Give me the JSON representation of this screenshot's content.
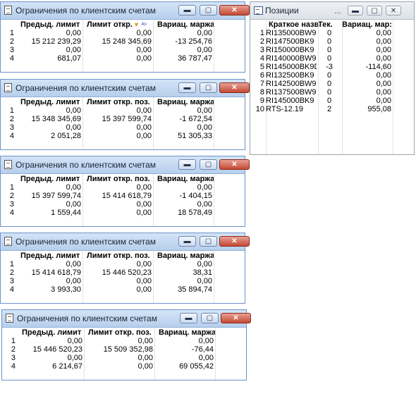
{
  "limit_windows": [
    {
      "title": "Ограничения по клиентским счетам",
      "headers": [
        "Предыд. лимит",
        "Лимит откр.",
        "Вариац. маржа"
      ],
      "filter_icons": true,
      "rows": [
        [
          "1",
          "0,00",
          "0,00",
          "0,00"
        ],
        [
          "2",
          "15 212 239,29",
          "15 248 345,69",
          "-13 254,76"
        ],
        [
          "3",
          "0,00",
          "0,00",
          "0,00"
        ],
        [
          "4",
          "681,07",
          "0,00",
          "36 787,47"
        ]
      ]
    },
    {
      "title": "Ограничения по клиентским счетам",
      "headers": [
        "Предыд. лимит",
        "Лимит откр. поз.",
        "Вариац. маржа"
      ],
      "filter_icons": false,
      "rows": [
        [
          "1",
          "0,00",
          "0,00",
          "0,00"
        ],
        [
          "2",
          "15 348 345,69",
          "15 397 599,74",
          "-1 672,54"
        ],
        [
          "3",
          "0,00",
          "0,00",
          "0,00"
        ],
        [
          "4",
          "2 051,28",
          "0,00",
          "51 305,33"
        ]
      ]
    },
    {
      "title": "Ограничения по клиентским счетам",
      "headers": [
        "Предыд. лимит",
        "Лимит откр. поз.",
        "Вариац. маржа"
      ],
      "filter_icons": false,
      "rows": [
        [
          "1",
          "0,00",
          "0,00",
          "0,00"
        ],
        [
          "2",
          "15 397 599,74",
          "15 414 618,79",
          "-1 404,15"
        ],
        [
          "3",
          "0,00",
          "0,00",
          "0,00"
        ],
        [
          "4",
          "1 559,44",
          "0,00",
          "18 578,49"
        ]
      ]
    },
    {
      "title": "Ограничения по клиентским счетам",
      "headers": [
        "Предыд. лимит",
        "Лимит откр. поз.",
        "Вариац. маржа"
      ],
      "filter_icons": false,
      "rows": [
        [
          "1",
          "0,00",
          "0,00",
          "0,00"
        ],
        [
          "2",
          "15 414 618,79",
          "15 446 520,23",
          "38,31"
        ],
        [
          "3",
          "0,00",
          "0,00",
          "0,00"
        ],
        [
          "4",
          "3 993,30",
          "0,00",
          "35 894,74"
        ]
      ]
    },
    {
      "title": "Ограничения по клиентским счетам",
      "headers": [
        "Предыд. лимит",
        "Лимит откр. поз.",
        "Вариац. маржа"
      ],
      "filter_icons": false,
      "rows": [
        [
          "1",
          "0,00",
          "0,00",
          "0,00"
        ],
        [
          "2",
          "15 446 520,23",
          "15 509 352,98",
          "-76,44"
        ],
        [
          "3",
          "0,00",
          "0,00",
          "0,00"
        ],
        [
          "4",
          "6 214,67",
          "0,00",
          "69 055,42"
        ]
      ]
    }
  ],
  "positions_window": {
    "title": "Позиции",
    "title_ellipsis": "...",
    "headers": [
      "Краткое назва",
      "Тек.",
      "Вариац. мар:"
    ],
    "rows": [
      [
        "1",
        "RI135000BW9",
        "0",
        "0,00"
      ],
      [
        "2",
        "RI147500BK9",
        "0",
        "0,00"
      ],
      [
        "3",
        "RI150000BK9",
        "0",
        "0,00"
      ],
      [
        "4",
        "RI140000BW9",
        "0",
        "0,00"
      ],
      [
        "5",
        "RI145000BK9D",
        "-3",
        "-114,60"
      ],
      [
        "6",
        "RI132500BK9",
        "0",
        "0,00"
      ],
      [
        "7",
        "RI142500BW9",
        "0",
        "0,00"
      ],
      [
        "8",
        "RI137500BW9",
        "0",
        "0,00"
      ],
      [
        "9",
        "RI145000BK9",
        "0",
        "0,00"
      ],
      [
        "10",
        "RTS-12.19",
        "2",
        "955,08"
      ]
    ]
  },
  "buttons": {
    "minimize": "▬",
    "maximize": "▢",
    "close": "✕"
  },
  "colors": {
    "titlebar_active": "#b7cfec",
    "close_button": "#c44933",
    "window_border": "#6f93c8"
  }
}
